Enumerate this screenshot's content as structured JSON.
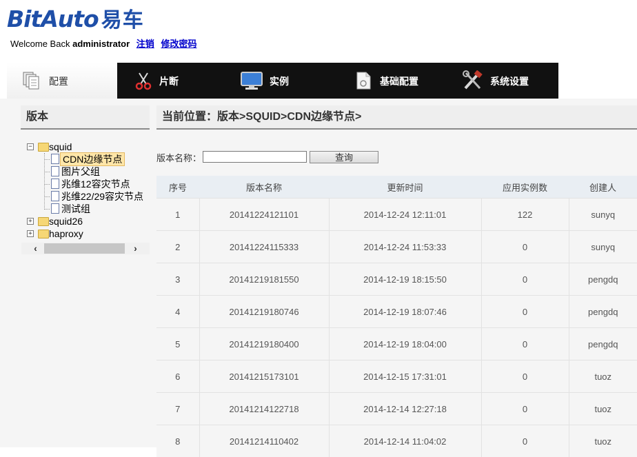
{
  "header": {
    "logo_text": "BitAuto",
    "logo_cn": "易车",
    "welcome_prefix": "Welcome Back",
    "username": "administrator",
    "logout_link": "注销",
    "change_password_link": "修改密码"
  },
  "nav": {
    "items": [
      {
        "label": "配置",
        "icon": "documents-icon"
      },
      {
        "label": "片断",
        "icon": "scissors-icon"
      },
      {
        "label": "实例",
        "icon": "monitor-icon"
      },
      {
        "label": "基础配置",
        "icon": "config-document-icon"
      },
      {
        "label": "系统设置",
        "icon": "tools-icon"
      }
    ]
  },
  "sidebar": {
    "title": "版本",
    "tree": [
      {
        "label": "squid",
        "expanded": true,
        "children": [
          {
            "label": "CDN边缘节点",
            "selected": true
          },
          {
            "label": "图片父组"
          },
          {
            "label": "兆维12容灾节点"
          },
          {
            "label": "兆维22/29容灾节点"
          },
          {
            "label": "测试组"
          }
        ]
      },
      {
        "label": "squid26",
        "expanded": false
      },
      {
        "label": "haproxy",
        "expanded": false
      }
    ]
  },
  "main": {
    "breadcrumb": "当前位置：版本>SQUID>CDN边缘节点>",
    "search": {
      "label": "版本名称：",
      "value": "",
      "button": "查询"
    },
    "table": {
      "headers": [
        "序号",
        "版本名称",
        "更新时间",
        "应用实例数",
        "创建人"
      ],
      "rows": [
        [
          "1",
          "20141224121101",
          "2014-12-24 12:11:01",
          "122",
          "sunyq"
        ],
        [
          "2",
          "20141224115333",
          "2014-12-24 11:53:33",
          "0",
          "sunyq"
        ],
        [
          "3",
          "20141219181550",
          "2014-12-19 18:15:50",
          "0",
          "pengdq"
        ],
        [
          "4",
          "20141219180746",
          "2014-12-19 18:07:46",
          "0",
          "pengdq"
        ],
        [
          "5",
          "20141219180400",
          "2014-12-19 18:04:00",
          "0",
          "pengdq"
        ],
        [
          "6",
          "20141215173101",
          "2014-12-15 17:31:01",
          "0",
          "tuoz"
        ],
        [
          "7",
          "20141214122718",
          "2014-12-14 12:27:18",
          "0",
          "tuoz"
        ],
        [
          "8",
          "20141214110402",
          "2014-12-14 11:04:02",
          "0",
          "tuoz"
        ]
      ]
    }
  },
  "colors": {
    "logo_blue": "#1f4fa8",
    "logo_red": "#d0202a",
    "nav_bg": "#111111",
    "link_blue": "#0000cc"
  }
}
